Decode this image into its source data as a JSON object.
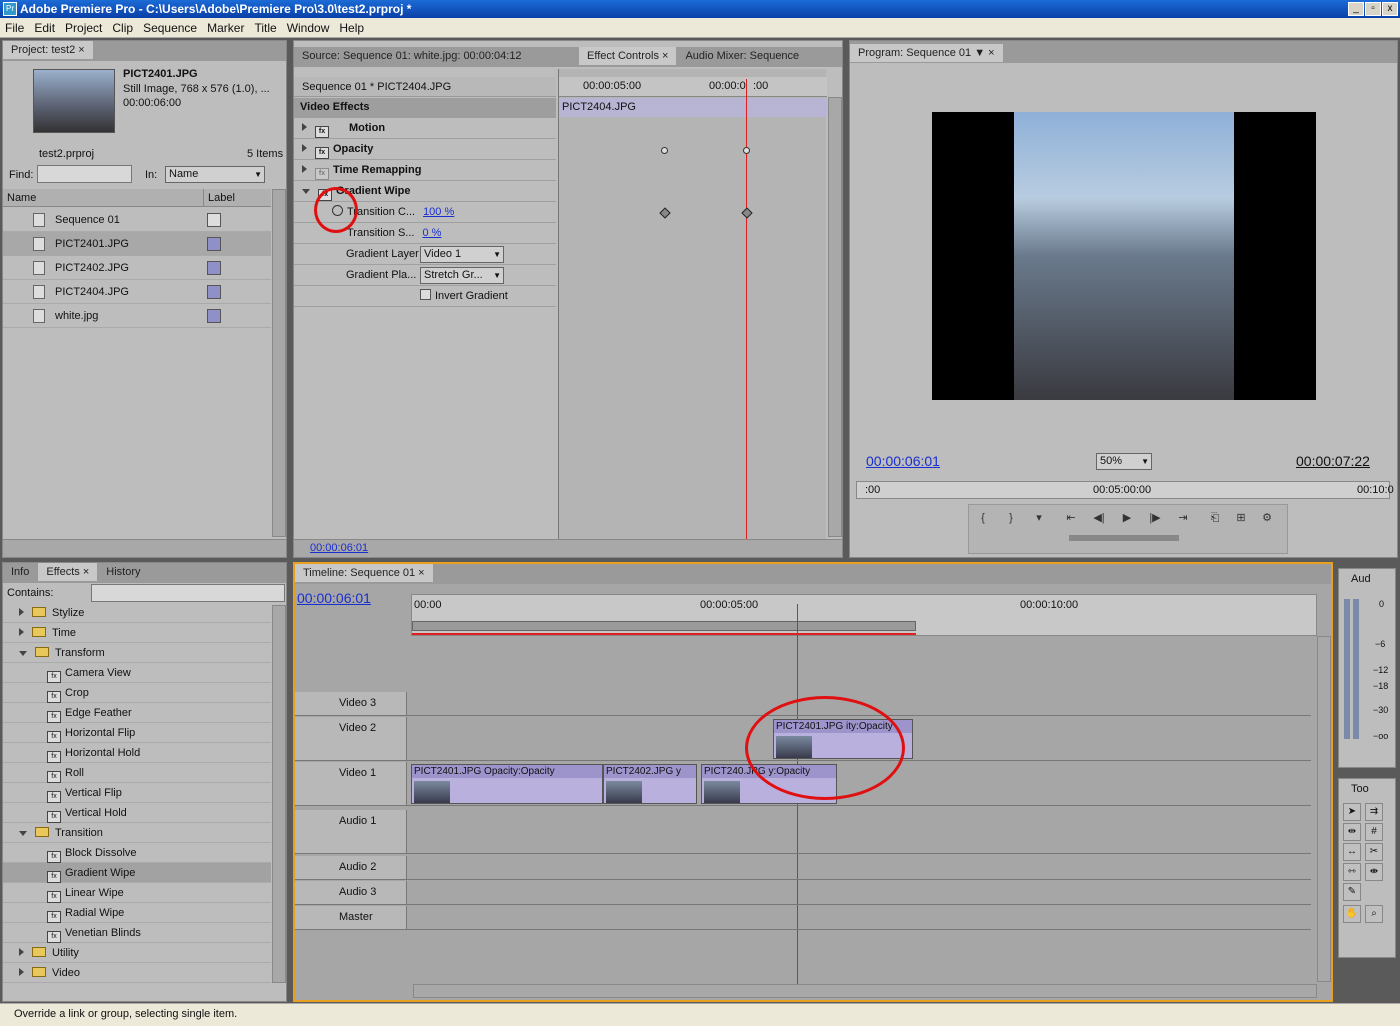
{
  "window": {
    "title": "Adobe Premiere Pro - C:\\Users\\Adobe\\Premiere Pro\\3.0\\test2.prproj *",
    "icon": "Pr",
    "min": "_",
    "max": "▫",
    "close": "x"
  },
  "menu": [
    "File",
    "Edit",
    "Project",
    "Clip",
    "Sequence",
    "Marker",
    "Title",
    "Window",
    "Help"
  ],
  "project": {
    "tab": "Project: test2",
    "preview_name": "PICT2401.JPG",
    "preview_info": "Still Image, 768 x 576 (1.0), ...",
    "preview_dur": "00:00:06:00",
    "file": "test2.prproj",
    "count": "5 Items",
    "find_label": "Find:",
    "in_label": "In:",
    "in_value": "Name",
    "col_name": "Name",
    "col_label": "Label",
    "items": [
      {
        "name": "Sequence 01",
        "color": "#dddddd"
      },
      {
        "name": "PICT2401.JPG",
        "color": "#9090c8"
      },
      {
        "name": "PICT2402.JPG",
        "color": "#9090c8"
      },
      {
        "name": "PICT2404.JPG",
        "color": "#9090c8"
      },
      {
        "name": "white.jpg",
        "color": "#9090c8"
      }
    ]
  },
  "source_tabs": [
    "Source: Sequence 01: white.jpg: 00:00:04:12",
    "Effect Controls",
    "Audio Mixer: Sequence"
  ],
  "ec": {
    "seq": "Sequence 01 * PICT2404.JPG",
    "t1": "00:00:05:00",
    "t2": "00:00:0",
    "t2b": ":00",
    "clip": "PICT2404.JPG",
    "section": "Video Effects",
    "effects": [
      "Motion",
      "Opacity",
      "Time Remapping",
      "Gradient Wipe"
    ],
    "tc_label": "Transition C...",
    "tc_val": "100 %",
    "ts_label": "Transition S...",
    "ts_val": "0 %",
    "gl_label": "Gradient Layer",
    "gl_val": "Video 1",
    "gp_label": "Gradient Pla...",
    "gp_val": "Stretch Gr...",
    "inv_label": "Invert Gradient",
    "time": "00:00:06:01"
  },
  "program": {
    "tab": "Program: Sequence 01",
    "time": "00:00:06:01",
    "zoom": "50%",
    "duration": "00:00:07:22",
    "r0": ":00",
    "r1": "00:05:00:00",
    "r2": "00:10:0"
  },
  "effects_panel": {
    "tabs": [
      "Info",
      "Effects",
      "History"
    ],
    "contains": "Contains:",
    "items": [
      {
        "n": "Stylize",
        "t": "folder",
        "lv": 1
      },
      {
        "n": "Time",
        "t": "folder",
        "lv": 1
      },
      {
        "n": "Transform",
        "t": "folder-open",
        "lv": 1
      },
      {
        "n": "Camera View",
        "t": "fx",
        "lv": 2
      },
      {
        "n": "Crop",
        "t": "fx",
        "lv": 2
      },
      {
        "n": "Edge Feather",
        "t": "fx",
        "lv": 2
      },
      {
        "n": "Horizontal Flip",
        "t": "fx",
        "lv": 2
      },
      {
        "n": "Horizontal Hold",
        "t": "fx",
        "lv": 2
      },
      {
        "n": "Roll",
        "t": "fx",
        "lv": 2
      },
      {
        "n": "Vertical Flip",
        "t": "fx",
        "lv": 2
      },
      {
        "n": "Vertical Hold",
        "t": "fx",
        "lv": 2
      },
      {
        "n": "Transition",
        "t": "folder-open",
        "lv": 1
      },
      {
        "n": "Block Dissolve",
        "t": "fx",
        "lv": 2
      },
      {
        "n": "Gradient Wipe",
        "t": "fx",
        "lv": 2,
        "sel": true
      },
      {
        "n": "Linear Wipe",
        "t": "fx",
        "lv": 2
      },
      {
        "n": "Radial Wipe",
        "t": "fx",
        "lv": 2
      },
      {
        "n": "Venetian Blinds",
        "t": "fx",
        "lv": 2
      },
      {
        "n": "Utility",
        "t": "folder",
        "lv": 1
      },
      {
        "n": "Video",
        "t": "folder",
        "lv": 1
      }
    ]
  },
  "timeline": {
    "tab": "Timeline: Sequence 01",
    "time": "00:00:06:01",
    "r0": "00:00",
    "r1": "00:00:05:00",
    "r2": "00:00:10:00",
    "tracks": {
      "v3": "Video 3",
      "v2": "Video 2",
      "v1": "Video 1",
      "a1": "Audio 1",
      "a2": "Audio 2",
      "a3": "Audio 3",
      "m": "Master"
    },
    "clips": {
      "v2": "PICT2401.JPG",
      "v2b": "ity:Opacity",
      "v1a": "PICT2401.JPG",
      "v1ab": "Opacity:Opacity",
      "v1b": "PICT2402.JPG",
      "v1bb": "y",
      "v1c": "PICT240",
      "v1cm": ".JPG",
      "v1cb": "y:Opacity"
    }
  },
  "audio_meter": {
    "tab": "Aud",
    "labels": [
      "0",
      "−6",
      "−12",
      "−18",
      "−30",
      "−oo"
    ]
  },
  "tools": {
    "tab": "Too"
  },
  "status": "Override a link or group, selecting single item."
}
